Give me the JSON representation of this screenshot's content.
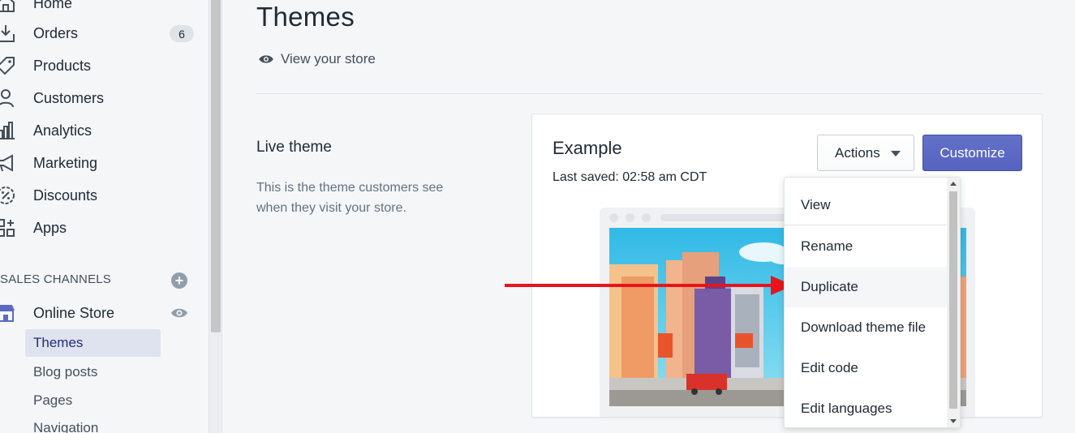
{
  "sidebar": {
    "items": [
      {
        "label": "Home",
        "icon": "home-icon"
      },
      {
        "label": "Orders",
        "icon": "orders-icon",
        "badge": "6"
      },
      {
        "label": "Products",
        "icon": "tag-icon"
      },
      {
        "label": "Customers",
        "icon": "person-icon"
      },
      {
        "label": "Analytics",
        "icon": "bar-chart-icon"
      },
      {
        "label": "Marketing",
        "icon": "megaphone-icon"
      },
      {
        "label": "Discounts",
        "icon": "discount-icon"
      },
      {
        "label": "Apps",
        "icon": "apps-icon"
      }
    ],
    "sales_channels_heading": "SALES CHANNELS",
    "online_store": {
      "label": "Online Store",
      "icon": "store-icon"
    },
    "sub_items": [
      "Themes",
      "Blog posts",
      "Pages",
      "Navigation"
    ],
    "active_sub_item": "Themes"
  },
  "main": {
    "title": "Themes",
    "view_store_label": "View your store",
    "live_theme": {
      "heading": "Live theme",
      "description": "This is the theme customers see when they visit your store."
    },
    "card": {
      "theme_name": "Example",
      "last_saved": "Last saved: 02:58 am CDT",
      "actions_label": "Actions",
      "customize_label": "Customize"
    }
  },
  "dropdown": {
    "items": [
      "View",
      "Rename",
      "Duplicate",
      "Download theme file",
      "Edit code",
      "Edit languages"
    ],
    "highlighted": "Duplicate"
  },
  "colors": {
    "primary_button": "#5c6ac4",
    "annotation_arrow": "#e8141b",
    "active_nav_bg": "#dfe3ef"
  }
}
